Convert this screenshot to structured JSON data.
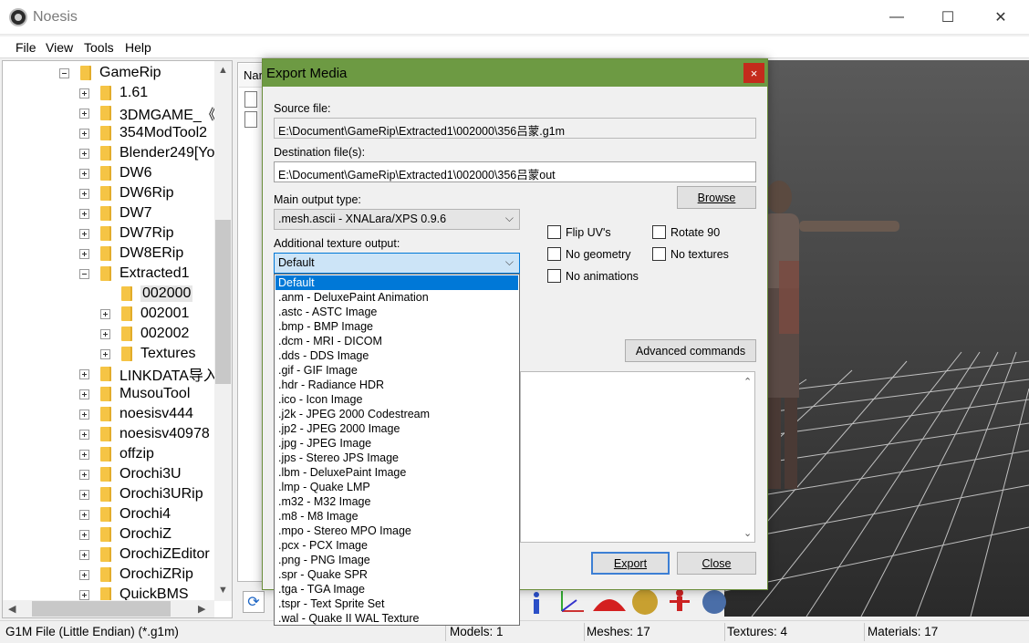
{
  "window": {
    "title": "Noesis",
    "minimize": "—",
    "maximize": "☐",
    "close": "✕"
  },
  "menu": [
    "File",
    "View",
    "Tools",
    "Help"
  ],
  "tree": {
    "root": "GameRip",
    "items": [
      {
        "label": "1.61",
        "level": 1,
        "expander": "plus"
      },
      {
        "label": "3DMGAME_《",
        "level": 1,
        "expander": "plus"
      },
      {
        "label": "354ModTool2",
        "level": 1,
        "expander": "plus"
      },
      {
        "label": "Blender249[Yo",
        "level": 1,
        "expander": "plus"
      },
      {
        "label": "DW6",
        "level": 1,
        "expander": "plus"
      },
      {
        "label": "DW6Rip",
        "level": 1,
        "expander": "plus"
      },
      {
        "label": "DW7",
        "level": 1,
        "expander": "plus"
      },
      {
        "label": "DW7Rip",
        "level": 1,
        "expander": "plus"
      },
      {
        "label": "DW8ERip",
        "level": 1,
        "expander": "plus"
      },
      {
        "label": "Extracted1",
        "level": 1,
        "expander": "minus"
      },
      {
        "label": "002000",
        "level": 2,
        "expander": "none",
        "selected": true
      },
      {
        "label": "002001",
        "level": 2,
        "expander": "plus"
      },
      {
        "label": "002002",
        "level": 2,
        "expander": "plus"
      },
      {
        "label": "Textures",
        "level": 2,
        "expander": "plus"
      },
      {
        "label": "LINKDATA导入",
        "level": 1,
        "expander": "plus"
      },
      {
        "label": "MusouTool",
        "level": 1,
        "expander": "plus"
      },
      {
        "label": "noesisv444",
        "level": 1,
        "expander": "plus"
      },
      {
        "label": "noesisv40978",
        "level": 1,
        "expander": "plus"
      },
      {
        "label": "offzip",
        "level": 1,
        "expander": "plus"
      },
      {
        "label": "Orochi3U",
        "level": 1,
        "expander": "plus"
      },
      {
        "label": "Orochi3URip",
        "level": 1,
        "expander": "plus"
      },
      {
        "label": "Orochi4",
        "level": 1,
        "expander": "plus"
      },
      {
        "label": "OrochiZ",
        "level": 1,
        "expander": "plus"
      },
      {
        "label": "OrochiZEditor",
        "level": 1,
        "expander": "plus"
      },
      {
        "label": "OrochiZRip",
        "level": 1,
        "expander": "plus"
      },
      {
        "label": "QuickBMS",
        "level": 1,
        "expander": "plus"
      }
    ]
  },
  "filelist": {
    "header": "Nar"
  },
  "dialog": {
    "title": "Export Media",
    "close": "×",
    "source_label": "Source file:",
    "source_value": "E:\\Document\\GameRip\\Extracted1\\002000\\356吕蒙.g1m",
    "dest_label": "Destination file(s):",
    "dest_value": "E:\\Document\\GameRip\\Extracted1\\002000\\356吕蒙out",
    "browse": "Browse",
    "main_output_label": "Main output type:",
    "main_output_value": ".mesh.ascii - XNALara/XPS 0.9.6",
    "texture_output_label": "Additional texture output:",
    "texture_output_value": "Default",
    "checks": {
      "flip_uvs": "Flip UV's",
      "rotate_90": "Rotate 90",
      "no_geometry": "No geometry",
      "no_textures": "No textures",
      "no_animations": "No animations"
    },
    "advanced": "Advanced commands",
    "export": "Export",
    "close_btn": "Close"
  },
  "dropdown_options": [
    "Default",
    ".anm - DeluxePaint Animation",
    ".astc - ASTC Image",
    ".bmp - BMP Image",
    ".dcm - MRI - DICOM",
    ".dds - DDS Image",
    ".gif - GIF Image",
    ".hdr - Radiance HDR",
    ".ico - Icon Image",
    ".j2k - JPEG 2000 Codestream",
    ".jp2 - JPEG 2000 Image",
    ".jpg - JPEG Image",
    ".jps - Stereo JPS Image",
    ".lbm - DeluxePaint Image",
    ".lmp - Quake LMP",
    ".m32 - M32 Image",
    ".m8 - M8 Image",
    ".mpo - Stereo MPO Image",
    ".pcx - PCX Image",
    ".png - PNG Image",
    ".spr - Quake SPR",
    ".tga - TGA Image",
    ".tspr - Text Sprite Set",
    ".wal - Quake II WAL Texture"
  ],
  "status": {
    "format": "G1M File (Little Endian) (*.g1m)",
    "models": "Models: 1",
    "meshes": "Meshes: 17",
    "textures": "Textures: 4",
    "materials": "Materials: 17"
  },
  "colors": {
    "dialog_title_bar": "#6d9a43",
    "selection": "#0078d7",
    "close_red": "#c42b1c"
  }
}
